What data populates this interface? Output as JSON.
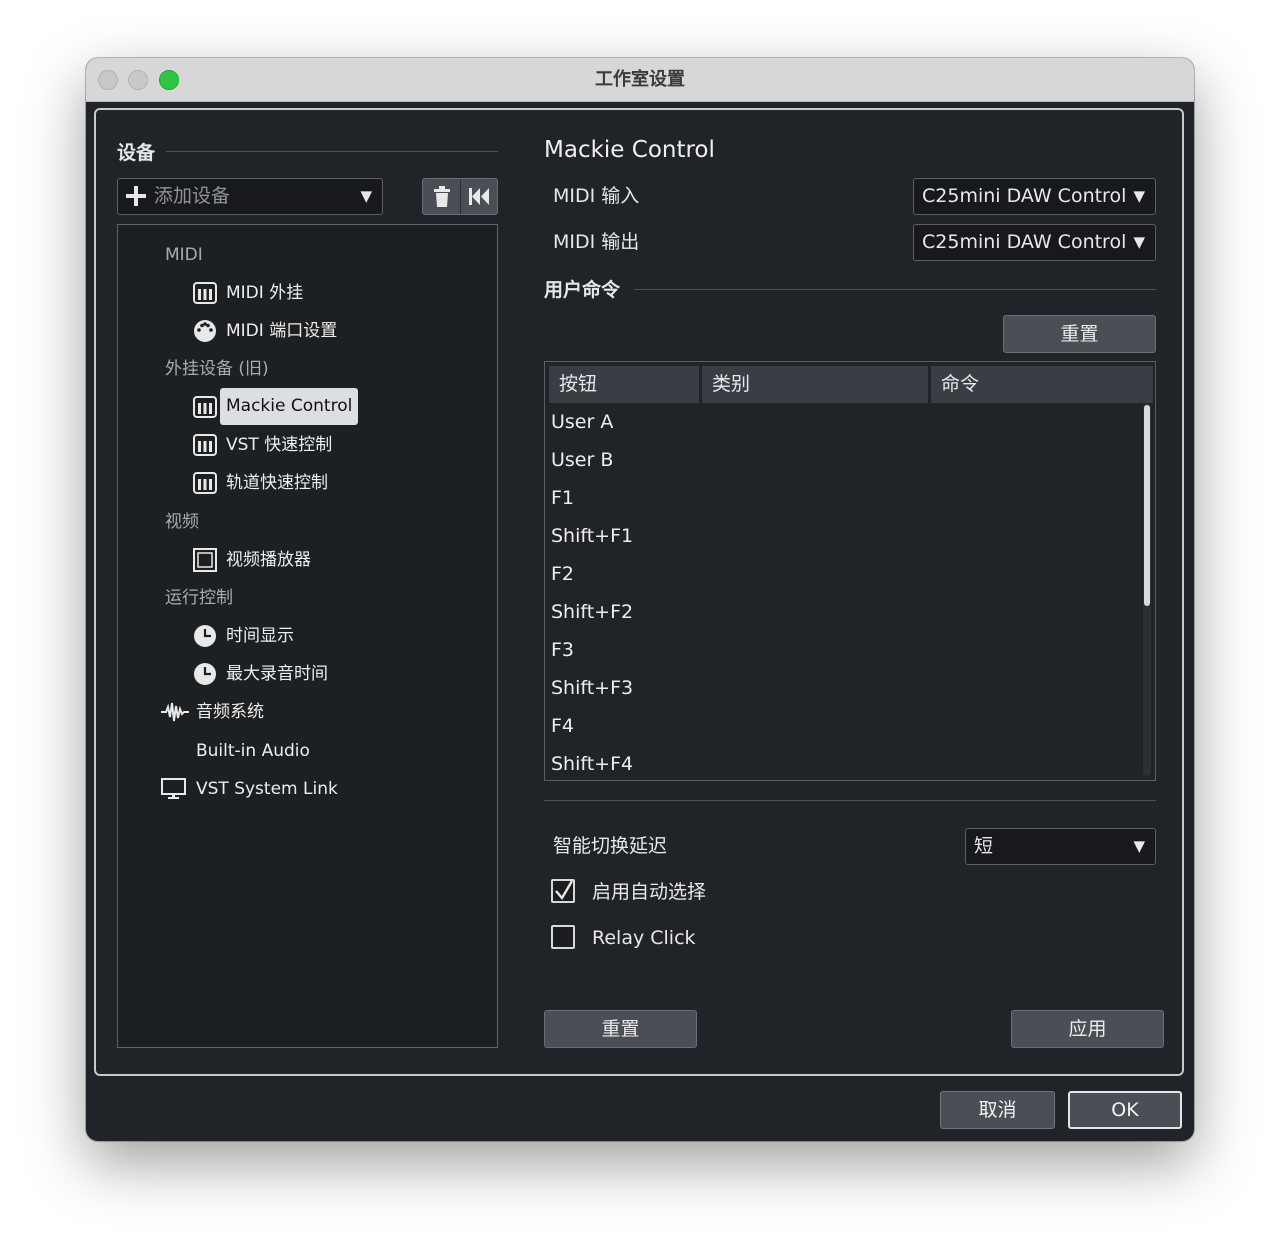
{
  "window": {
    "title": "工作室设置"
  },
  "devices": {
    "heading": "设备",
    "add_device_placeholder": "添加设备",
    "dropdown_arrow": "▼",
    "delete_icon": "trash-icon",
    "reset_icon": "skip-back-icon"
  },
  "tree": {
    "categories": {
      "midi": "MIDI",
      "external_legacy": "外挂设备 (旧)",
      "video": "视频",
      "transport": "运行控制"
    },
    "items": {
      "midi_external": "MIDI 外挂",
      "midi_port_setup": "MIDI 端口设置",
      "mackie_control": "Mackie Control",
      "vst_quick_control": "VST 快速控制",
      "track_quick_control": "轨道快速控制",
      "video_player": "视频播放器",
      "time_display": "时间显示",
      "max_record_time": "最大录音时间",
      "audio_system": "音频系统",
      "builtin_audio": "Built-in Audio",
      "vst_system_link": "VST System Link"
    },
    "selected": "mackie_control"
  },
  "detail": {
    "title": "Mackie Control",
    "midi_input_label": "MIDI 输入",
    "midi_input_value": "C25mini DAW Control",
    "midi_output_label": "MIDI 输出",
    "midi_output_value": "C25mini DAW Control",
    "user_commands_heading": "用户命令",
    "reset_top_label": "重置",
    "table": {
      "columns": [
        "按钮",
        "类别",
        "命令"
      ],
      "rows": [
        "User A",
        "User B",
        "F1",
        "Shift+F1",
        "F2",
        "Shift+F2",
        "F3",
        "Shift+F3",
        "F4",
        "Shift+F4"
      ]
    },
    "smart_switch_label": "智能切换延迟",
    "smart_switch_value": "短",
    "enable_auto_select_label": "启用自动选择",
    "enable_auto_select_checked": true,
    "relay_click_label": "Relay Click",
    "relay_click_checked": false,
    "reset_bottom_label": "重置",
    "apply_label": "应用"
  },
  "footer": {
    "cancel_label": "取消",
    "ok_label": "OK"
  }
}
